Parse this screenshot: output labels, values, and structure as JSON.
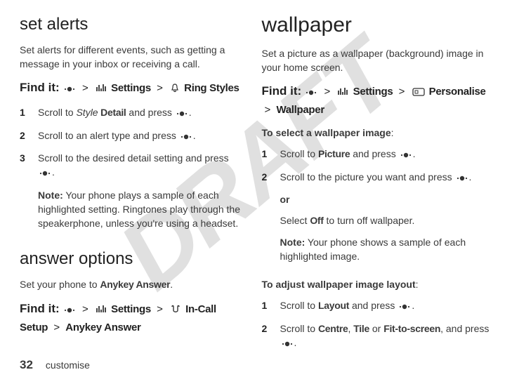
{
  "watermark": "DRAFT",
  "left": {
    "alerts": {
      "heading": "set alerts",
      "intro": "Set alerts for different events, such as getting a message in your inbox or receiving a call.",
      "findit": {
        "lead": "Find it:",
        "settings": "Settings",
        "ringstyles": "Ring Styles"
      },
      "steps": [
        {
          "num": "1",
          "pre": "Scroll to ",
          "boldItalic": "Style",
          "boldAfter": " Detail",
          "post": " and press ",
          "tail": "."
        },
        {
          "num": "2",
          "full": "Scroll to an alert type and press ",
          "tail": "."
        },
        {
          "num": "3",
          "full": "Scroll to the desired detail setting and press ",
          "tail": ".",
          "noteLead": "Note:",
          "noteBody": " Your phone plays a sample of each highlighted setting. Ringtones play through the speakerphone, unless you're using a headset."
        }
      ]
    },
    "answer": {
      "heading": "answer options",
      "introPre": "Set your phone to ",
      "introBold": "Anykey Answer",
      "introTail": ".",
      "findit": {
        "lead": "Find it:",
        "settings": "Settings",
        "incall": "In-Call Setup",
        "anykey": "Anykey Answer"
      }
    }
  },
  "right": {
    "wallpaper": {
      "heading": "wallpaper",
      "intro": "Set a picture as a wallpaper (background) image in your home screen.",
      "findit": {
        "lead": "Find it:",
        "settings": "Settings",
        "personalise": "Personalise",
        "wallpaper": "Wallpaper"
      },
      "selectLead": "To select a wallpaper image",
      "steps1": [
        {
          "num": "1",
          "pre": "Scroll to ",
          "bold": "Picture",
          "post": " and press ",
          "tail": "."
        },
        {
          "num": "2",
          "full": "Scroll to the picture you want and press ",
          "tail": ".",
          "or": "or",
          "selPre": "Select ",
          "selBold": "Off",
          "selPost": " to turn off wallpaper.",
          "noteLead": "Note:",
          "noteBody": " Your phone shows a sample of each highlighted image."
        }
      ],
      "adjustLead": "To adjust wallpaper image layout",
      "steps2": [
        {
          "num": "1",
          "pre": "Scroll to ",
          "bold": "Layout",
          "post": " and press ",
          "tail": "."
        },
        {
          "num": "2",
          "pre": "Scroll to ",
          "b1": "Centre",
          "sep1": ", ",
          "b2": "Tile",
          "sep2": " or ",
          "b3": "Fit-to-screen",
          "post": ", and press ",
          "tail": "."
        }
      ]
    }
  },
  "footer": {
    "page": "32",
    "label": "customise"
  },
  "glyphs": {
    "gt": ">"
  }
}
